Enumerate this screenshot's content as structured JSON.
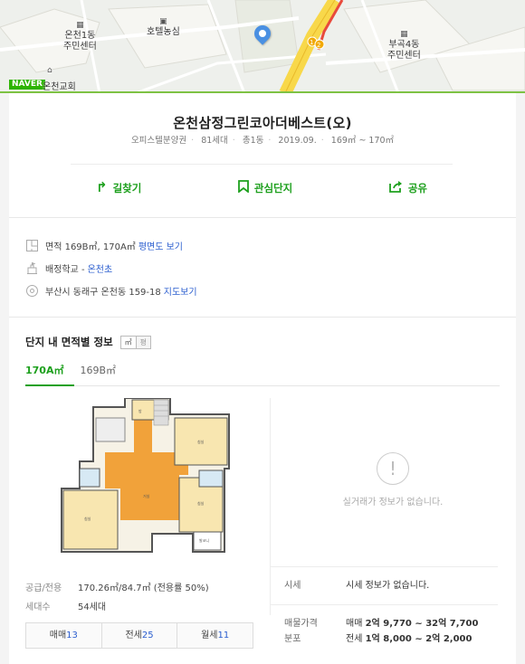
{
  "map": {
    "labels": {
      "onchon1dong": "온천1동",
      "onchon1dong_center": "주민센터",
      "hotel_nongsim": "호텔농심",
      "bugok4dong": "부곡4동",
      "bugok4dong_center": "주민센터",
      "church": "온천교회",
      "naver": "NAVER"
    },
    "colors": {
      "road_major": "#f8d84a",
      "road_red": "#e84a3c",
      "accent": "#7ec244"
    }
  },
  "complex": {
    "title": "온천삼정그린코아더베스트(오)",
    "subtitle": {
      "type": "오피스텔분양권",
      "households": "81세대",
      "buildings": "총1동",
      "date": "2019.09.",
      "area_range": "169㎡ ~ 170㎡"
    }
  },
  "actions": {
    "directions": "길찾기",
    "favorite": "관심단지",
    "share": "공유"
  },
  "info": {
    "area_text": "면적 169B㎡, 170A㎡",
    "area_link": "평면도 보기",
    "school_text": "배정학교 -",
    "school_link": "온천초",
    "address_text": "부산시 동래구 온천동 159-18",
    "address_link": "지도보기"
  },
  "area_section": {
    "title": "단지 내 면적별 정보",
    "unit_sqm": "㎡",
    "unit_pyeong": "평",
    "tabs": [
      {
        "label": "170A㎡",
        "active": true
      },
      {
        "label": "169B㎡",
        "active": false
      }
    ],
    "no_trade_msg": "실거래가 정보가 없습니다.",
    "specs": {
      "supply_label": "공급/전용",
      "supply_value": "170.26㎡/84.7㎡ (전용률 50%)",
      "households_label": "세대수",
      "households_value": "54세대"
    },
    "deals": [
      {
        "label": "매매",
        "count": "13"
      },
      {
        "label": "전세",
        "count": "25"
      },
      {
        "label": "월세",
        "count": "11"
      }
    ],
    "price": {
      "market_label": "시세",
      "market_value": "시세 정보가 없습니다.",
      "dist_label_1": "매물가격",
      "dist_label_2": "분포",
      "sale_prefix": "매매",
      "sale_range": "2억 9,770 ~ 32억 7,700",
      "jeonse_prefix": "전세",
      "jeonse_range": "1억 8,000 ~ 2억 2,000"
    }
  }
}
